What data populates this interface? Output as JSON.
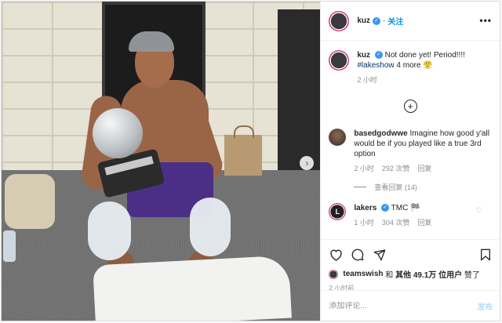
{
  "header": {
    "username": "kuz",
    "follow_label": "关注",
    "more_label": "•••"
  },
  "caption": {
    "username": "kuz",
    "text": "Not done yet! Period!!!!",
    "hashtag": "#lakeshow",
    "more": "4 more",
    "emoji": "😤",
    "time": "2 小时"
  },
  "comments": [
    {
      "username": "basedgodwwe",
      "text": "Imagine how good y'all would be if you played like a true 3rd option",
      "time": "2 小时",
      "likes": "292 次赞",
      "reply_label": "回复",
      "view_replies": "查看回复 (14)"
    },
    {
      "username": "lakers",
      "text": "TMC 🏁",
      "time": "1 小时",
      "likes": "304 次赞",
      "reply_label": "回复"
    }
  ],
  "likes": {
    "user": "teamswish",
    "connector": "和",
    "others": "其他 49.1万 位用户",
    "suffix": "赞了"
  },
  "post_time": "2 小时前",
  "composer": {
    "placeholder": "添加评论...",
    "publish_label": "发布"
  },
  "colors": {
    "link": "#0095f6",
    "verified": "#3897f0",
    "publish_disabled": "#b3dbff",
    "muted_text": "#8e8e8e"
  },
  "icons": [
    "more-icon",
    "verified-icon",
    "heart-icon",
    "comment-icon",
    "share-icon",
    "bookmark-icon",
    "load-more-icon",
    "next-arrow-icon"
  ]
}
